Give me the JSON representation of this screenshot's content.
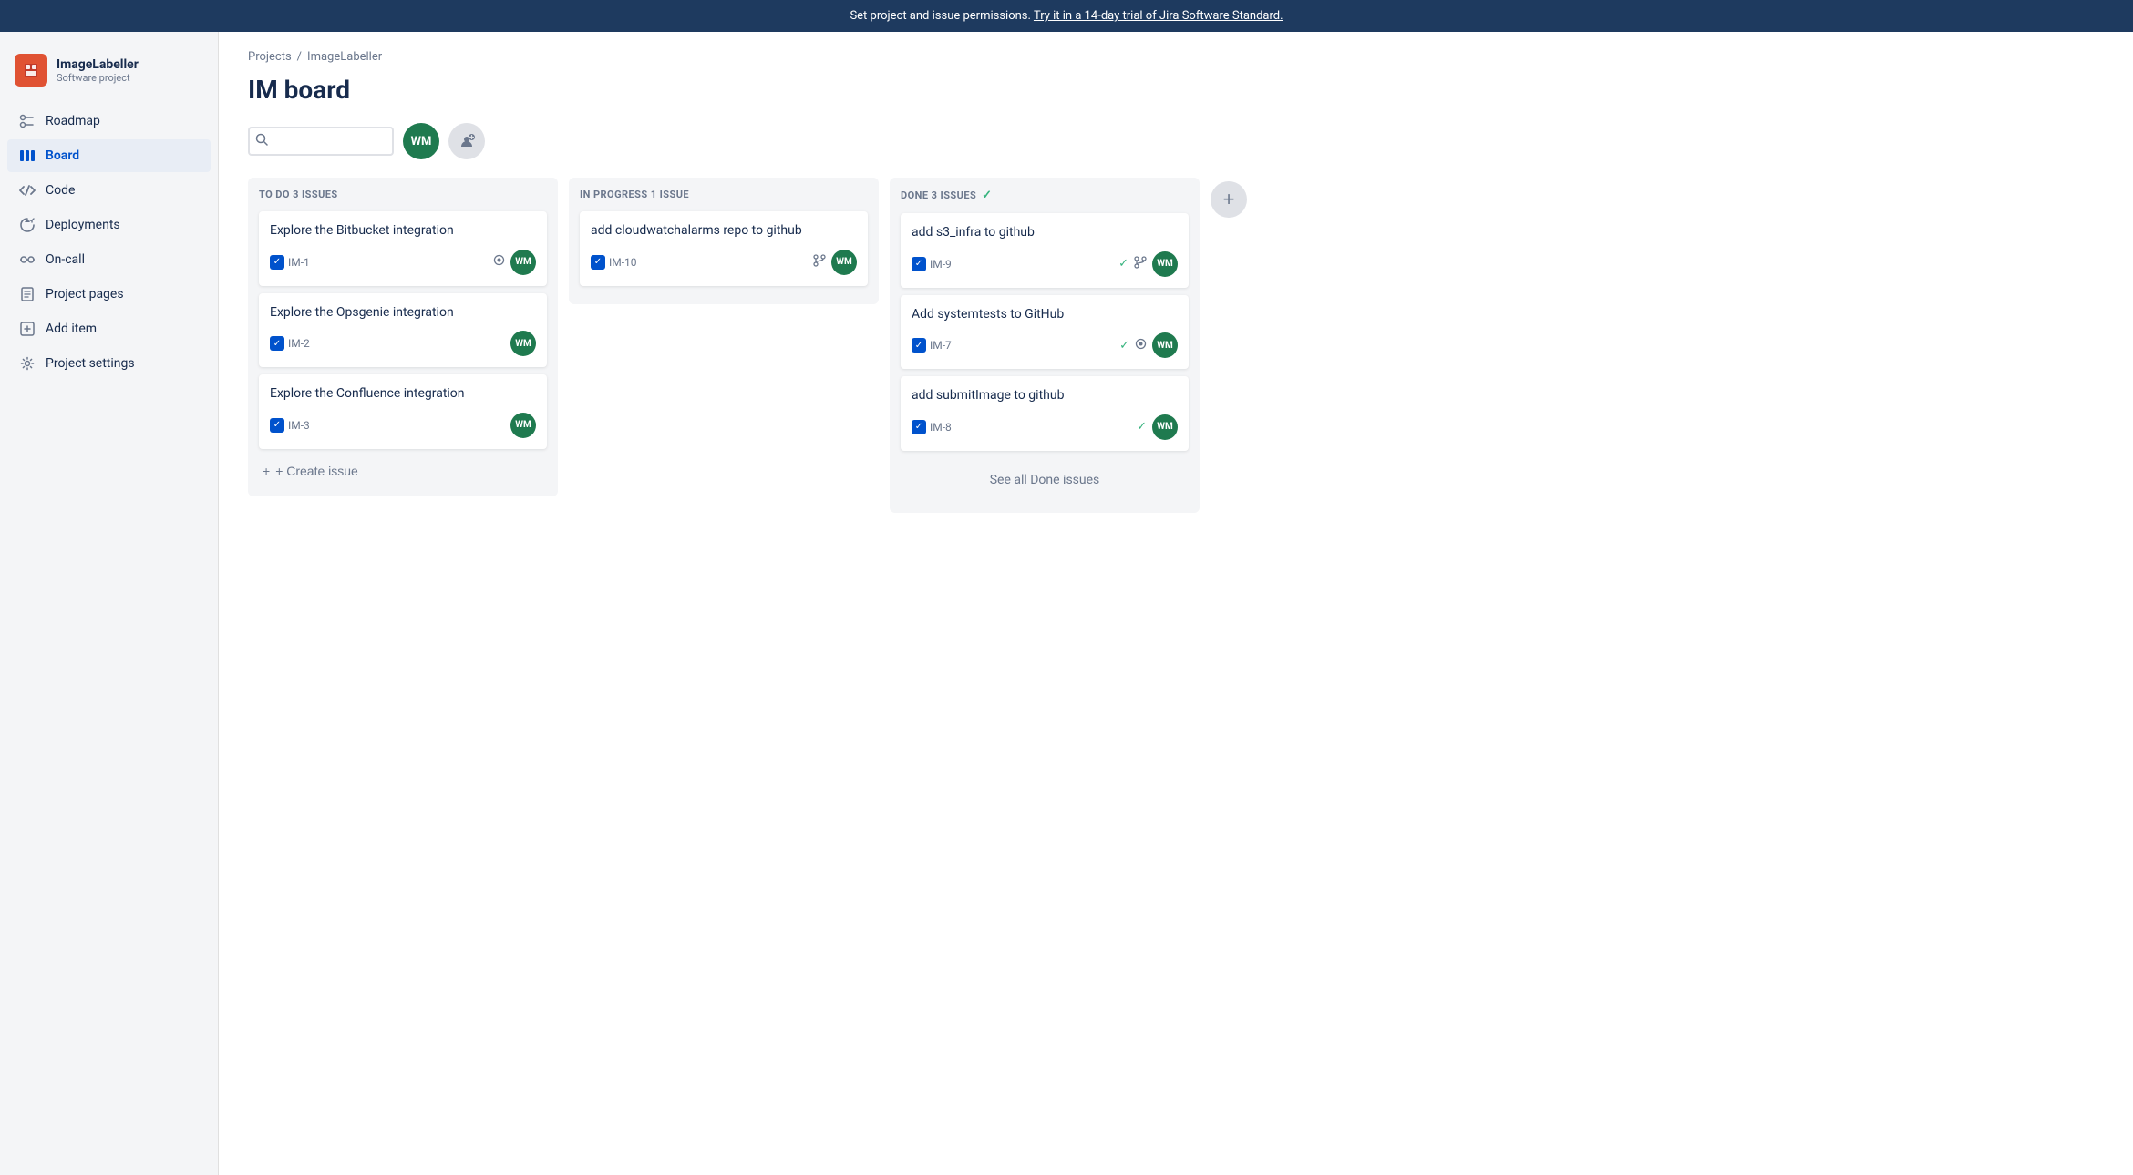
{
  "banner": {
    "text": "Set project and issue permissions.",
    "link_text": "Try it in a 14-day trial of Jira Software Standard."
  },
  "sidebar": {
    "project_name": "ImageLabeller",
    "project_type": "Software project",
    "project_icon": "🖼",
    "nav_items": [
      {
        "id": "roadmap",
        "label": "Roadmap",
        "icon": "roadmap"
      },
      {
        "id": "board",
        "label": "Board",
        "icon": "board",
        "active": true
      },
      {
        "id": "code",
        "label": "Code",
        "icon": "code"
      },
      {
        "id": "deployments",
        "label": "Deployments",
        "icon": "deployments"
      },
      {
        "id": "oncall",
        "label": "On-call",
        "icon": "oncall"
      },
      {
        "id": "project-pages",
        "label": "Project pages",
        "icon": "pages"
      },
      {
        "id": "add-item",
        "label": "Add item",
        "icon": "add"
      },
      {
        "id": "project-settings",
        "label": "Project settings",
        "icon": "settings"
      }
    ]
  },
  "breadcrumb": {
    "items": [
      "Projects",
      "ImageLabeller"
    ]
  },
  "page_title": "IM board",
  "toolbar": {
    "search_placeholder": "",
    "avatar_initials": "WM",
    "add_assignee_label": "+"
  },
  "columns": [
    {
      "id": "todo",
      "header": "TO DO 3 ISSUES",
      "has_check": false,
      "cards": [
        {
          "title": "Explore the Bitbucket integration",
          "id": "IM-1",
          "meta_icons": [
            "pin"
          ],
          "avatar": "WM"
        },
        {
          "title": "Explore the Opsgenie integration",
          "id": "IM-2",
          "meta_icons": [],
          "avatar": "WM"
        },
        {
          "title": "Explore the Confluence integration",
          "id": "IM-3",
          "meta_icons": [],
          "avatar": "WM"
        }
      ],
      "create_issue_label": "+ Create issue"
    },
    {
      "id": "in-progress",
      "header": "IN PROGRESS 1 ISSUE",
      "has_check": false,
      "cards": [
        {
          "title": "add cloudwatchalarms repo to github",
          "id": "IM-10",
          "meta_icons": [
            "branch"
          ],
          "avatar": "WM"
        }
      ],
      "create_issue_label": null
    },
    {
      "id": "done",
      "header": "DONE 3 ISSUES",
      "has_check": true,
      "cards": [
        {
          "title": "add s3_infra to github",
          "id": "IM-9",
          "meta_icons": [
            "check",
            "branch"
          ],
          "avatar": "WM"
        },
        {
          "title": "Add systemtests to GitHub",
          "id": "IM-7",
          "meta_icons": [
            "check",
            "pin"
          ],
          "avatar": "WM"
        },
        {
          "title": "add submitImage to github",
          "id": "IM-8",
          "meta_icons": [
            "check"
          ],
          "avatar": "WM"
        }
      ],
      "create_issue_label": null,
      "see_all_label": "See all Done issues"
    }
  ]
}
